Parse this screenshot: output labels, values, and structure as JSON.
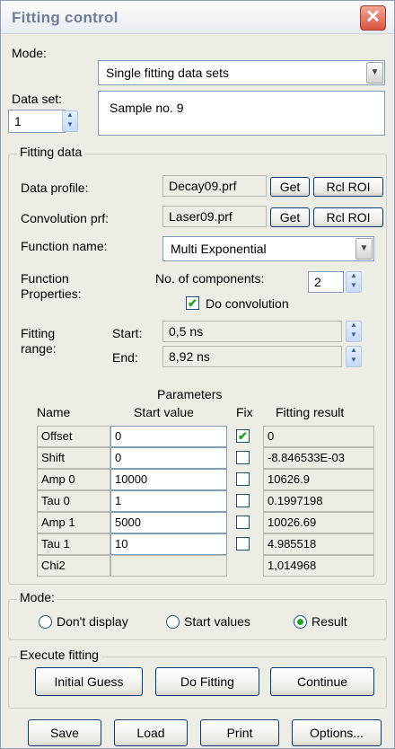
{
  "window": {
    "title": "Fitting control",
    "close_label": "✕"
  },
  "mode": {
    "label": "Mode:",
    "value": "Single fitting data sets"
  },
  "data_set": {
    "label": "Data set:",
    "value": "1",
    "name": "Sample no. 9"
  },
  "fitting_data": {
    "group_title": "Fitting data",
    "data_profile": {
      "label": "Data profile:",
      "value": "Decay09.prf",
      "get_label": "Get",
      "rcl_label": "Rcl ROI"
    },
    "convolution": {
      "label": "Convolution prf:",
      "value": "Laser09.prf",
      "get_label": "Get",
      "rcl_label": "Rcl ROI"
    },
    "function_name": {
      "label": "Function name:",
      "value": "Multi Exponential"
    },
    "function_properties": {
      "label_line1": "Function",
      "label_line2": "Properties:",
      "components_label": "No. of components:",
      "components_value": "2",
      "convolution_checkbox_label": "Do convolution",
      "convolution_checked": true
    },
    "range": {
      "label_line1": "Fitting",
      "label_line2": "range:",
      "start_label": "Start:",
      "start_value": "0,5 ns",
      "end_label": "End:",
      "end_value": "8,92 ns"
    }
  },
  "parameters": {
    "title": "Parameters",
    "headers": {
      "name": "Name",
      "start": "Start value",
      "fix": "Fix",
      "result": "Fitting result"
    },
    "rows": [
      {
        "name": "Offset",
        "start": "0",
        "fix": true,
        "result": "0"
      },
      {
        "name": "Shift",
        "start": "0",
        "fix": false,
        "result": "-8.846533E-03"
      },
      {
        "name": "Amp 0",
        "start": "10000",
        "fix": false,
        "result": "10626.9"
      },
      {
        "name": "Tau 0",
        "start": "1",
        "fix": false,
        "result": "0.1997198"
      },
      {
        "name": "Amp 1",
        "start": "5000",
        "fix": false,
        "result": "10026.69"
      },
      {
        "name": "Tau 1",
        "start": "10",
        "fix": false,
        "result": "4.985518"
      },
      {
        "name": "Chi2",
        "start": "",
        "fix": null,
        "result": "1,014968"
      }
    ]
  },
  "display_mode": {
    "group_title": "Mode:",
    "options": [
      "Don't display",
      "Start values",
      "Result"
    ],
    "selected": "Result"
  },
  "execute": {
    "group_title": "Execute fitting",
    "initial_guess": "Initial Guess",
    "do_fitting": "Do Fitting",
    "continue": "Continue"
  },
  "footer": {
    "save": "Save",
    "load": "Load",
    "print": "Print",
    "options": "Options..."
  },
  "colors": {
    "check_green": "#21a121",
    "close_red": "#d9533e",
    "title_text": "#6f7d96"
  }
}
